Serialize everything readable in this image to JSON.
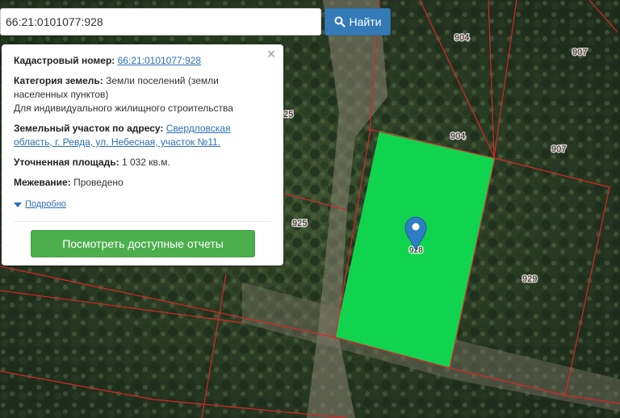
{
  "search": {
    "value": "66:21:0101077:928",
    "button_label": "Найти",
    "icon": "search-icon"
  },
  "popup": {
    "cadastral_label": "Кадастровый номер:",
    "cadastral_value": "66:21:0101077:928",
    "category_label": "Категория земель:",
    "category_value": "Земли поселений (земли населенных пунктов)",
    "category_use": "Для индивидуального жилищного строительства",
    "address_label": "Земельный участок по адресу:",
    "address_value": "Свердловская область, г. Ревда, ул. Небесная, участок №11.",
    "area_label": "Уточненная площадь:",
    "area_value": "1 032 кв.м.",
    "survey_label": "Межевание:",
    "survey_value": "Проведено",
    "more_label": "Подробно",
    "reports_button": "Посмотреть доступные отчеты",
    "close_icon": "close-icon"
  },
  "map": {
    "parcel_labels": {
      "p904a": "904",
      "p907a": "907",
      "p904b": "904",
      "p907b": "907",
      "p925": "925",
      "p929": "929",
      "p928": "928",
      "p925_partial": "25"
    },
    "colors": {
      "selected_parcel": "#11d44e",
      "boundary": "#d9262b",
      "marker": "#2f7fc4",
      "primary_button": "#337ab7",
      "success_button": "#4cae4c"
    },
    "marker_icon": "map-pin-icon"
  }
}
